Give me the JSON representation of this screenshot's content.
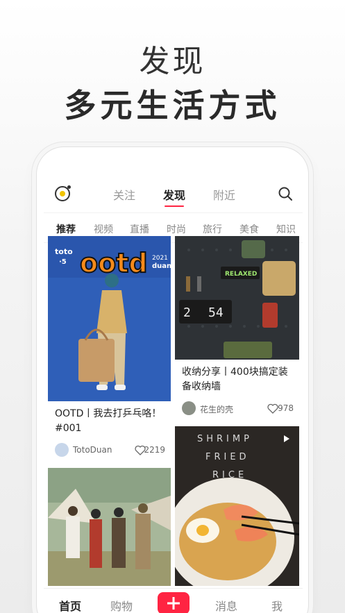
{
  "hero": {
    "line1": "发现",
    "line2": "多元生活方式"
  },
  "topbar": {
    "tabs": [
      {
        "label": "关注"
      },
      {
        "label": "发现"
      },
      {
        "label": "附近"
      }
    ]
  },
  "categories": [
    "推荐",
    "视频",
    "直播",
    "时尚",
    "旅行",
    "美食",
    "知识"
  ],
  "feed": [
    {
      "title": "OOTD丨我去打乒乓咯！#001",
      "author": "TotoDuan",
      "likes": "2219",
      "image_text_main": "ootd",
      "image_text_left": "toto\n·5",
      "image_text_right": "2021\nduan"
    },
    {
      "title": "收纳分享丨400块搞定装备收纳墙",
      "author": "花生的壳",
      "likes": "978",
      "image_text_sign": "RELAXED",
      "image_text_clock_a": "2",
      "image_text_clock_b": "54"
    },
    {
      "title": "",
      "author": "",
      "likes": ""
    },
    {
      "title": "",
      "author": "",
      "likes": "",
      "image_text_line1": "SHRIMP",
      "image_text_line2": "FRIED",
      "image_text_line3": "RICE"
    }
  ],
  "bottom_nav": {
    "home": "首页",
    "shop": "购物",
    "messages": "消息",
    "me": "我"
  },
  "colors": {
    "accent": "#ff2442",
    "text": "#222222",
    "muted": "#888888"
  }
}
